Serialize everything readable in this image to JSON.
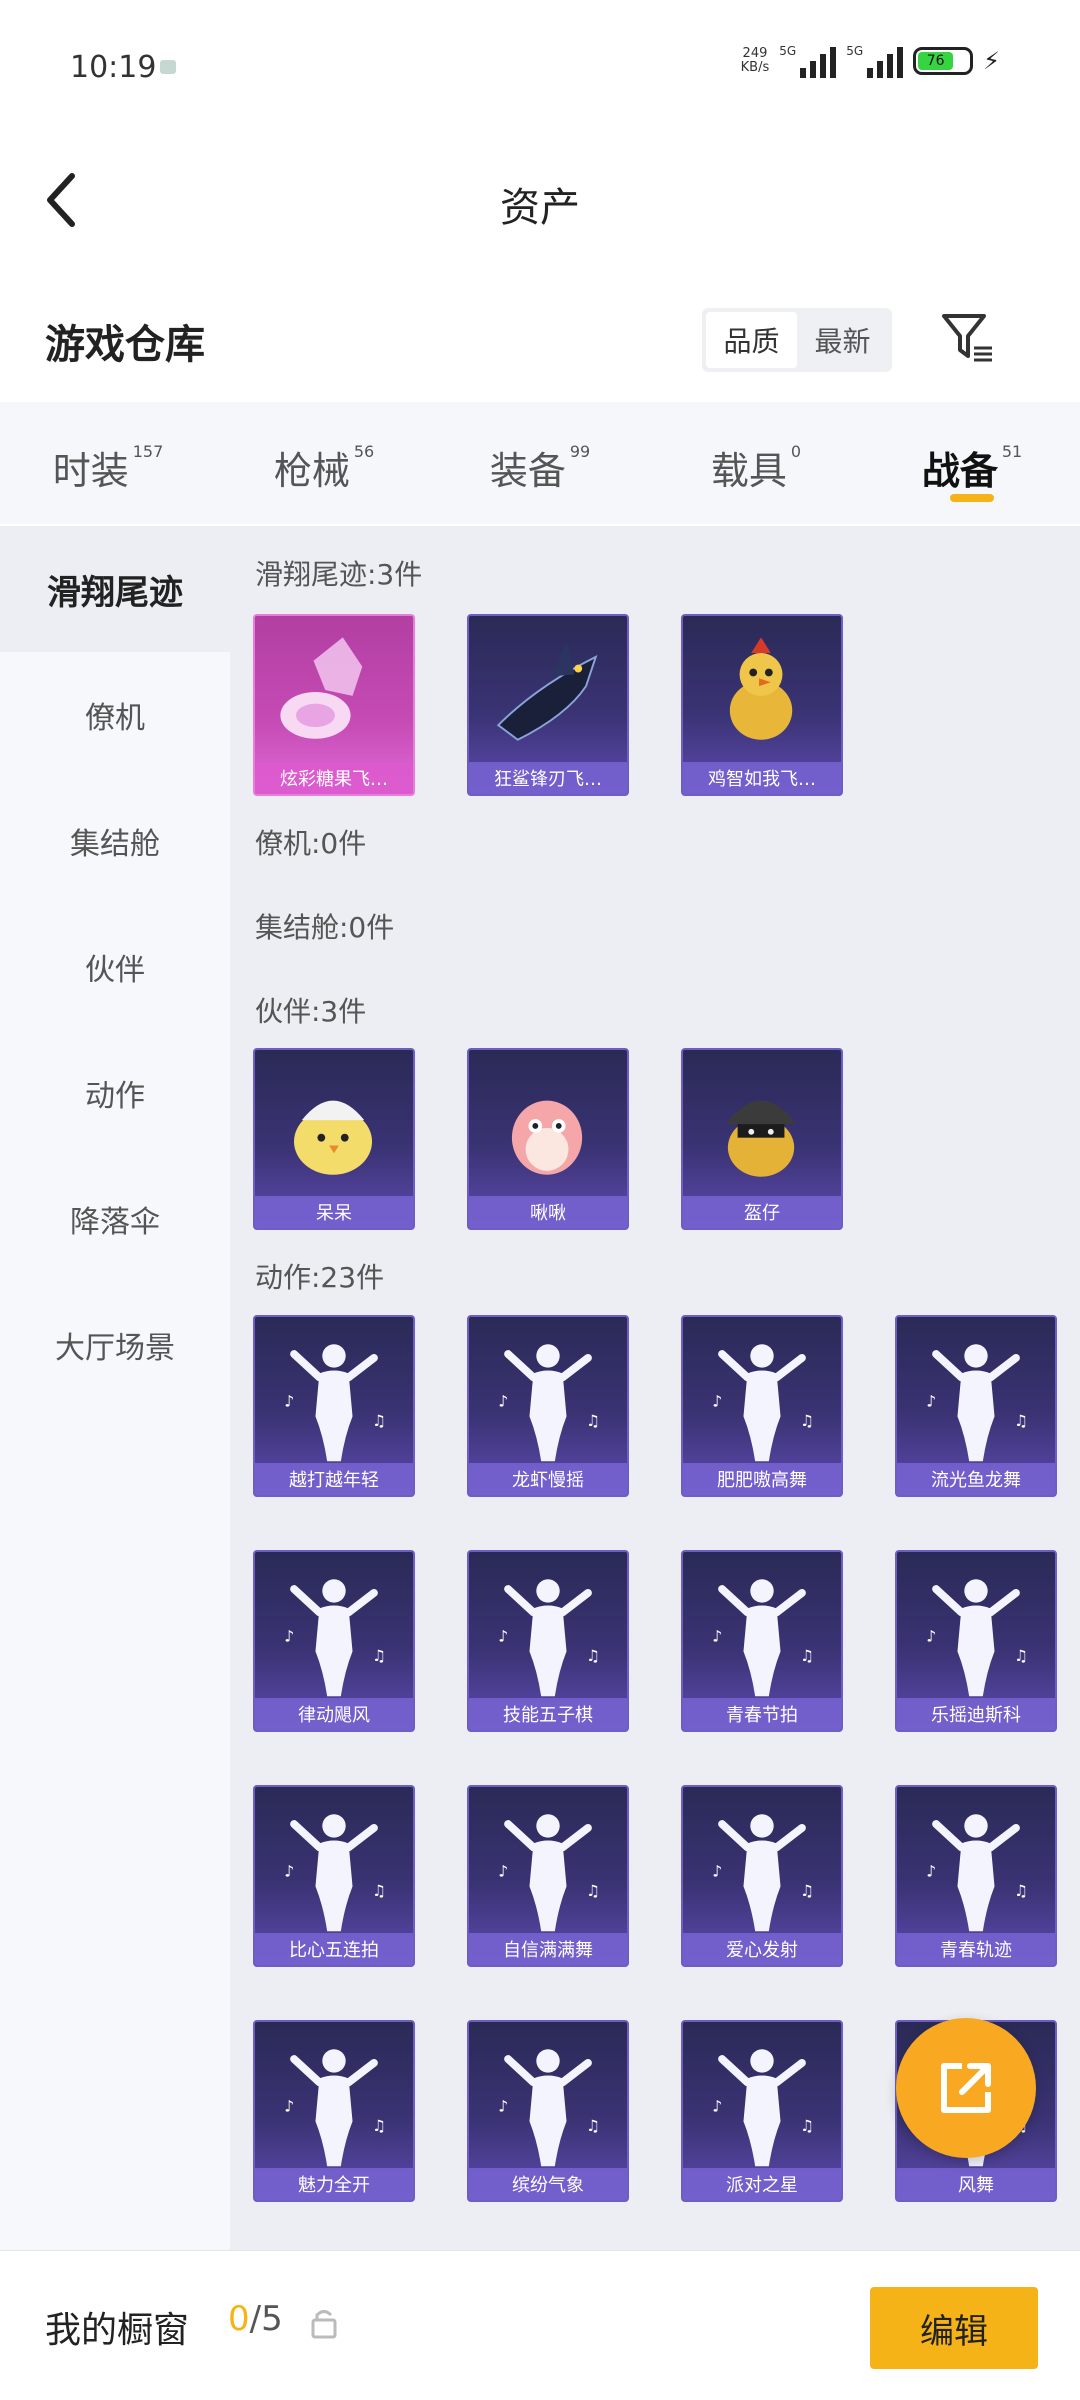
{
  "status_bar": {
    "time": "10:19",
    "net_speed": "249",
    "net_unit": "KB/s",
    "signal1": "5G",
    "signal2": "5G",
    "battery": "76"
  },
  "header": {
    "title": "资产"
  },
  "warehouse": {
    "title": "游戏仓库",
    "sort_quality": "品质",
    "sort_newest": "最新"
  },
  "categories": [
    {
      "label": "时装",
      "count": "157"
    },
    {
      "label": "枪械",
      "count": "56"
    },
    {
      "label": "装备",
      "count": "99"
    },
    {
      "label": "载具",
      "count": "0"
    },
    {
      "label": "战备",
      "count": "51"
    }
  ],
  "sidebar": [
    "滑翔尾迹",
    "僚机",
    "集结舱",
    "伙伴",
    "动作",
    "降落伞",
    "大厅场景"
  ],
  "sections": {
    "glide": {
      "title": "滑翔尾迹:3件",
      "items": [
        "炫彩糖果飞…",
        "狂鲨锋刃飞…",
        "鸡智如我飞…"
      ]
    },
    "wingman": {
      "title": "僚机:0件"
    },
    "capsule": {
      "title": "集结舱:0件"
    },
    "partner": {
      "title": "伙伴:3件",
      "items": [
        "呆呆",
        "啾啾",
        "盔仔"
      ]
    },
    "emote": {
      "title": "动作:23件",
      "items": [
        "越打越年轻",
        "龙虾慢摇",
        "肥肥嗷高舞",
        "流光鱼龙舞",
        "律动飓风",
        "技能五子棋",
        "青春节拍",
        "乐摇迪斯科",
        "比心五连拍",
        "自信满满舞",
        "爱心发射",
        "青春轨迹",
        "魅力全开",
        "缤纷气象",
        "派对之星",
        "风舞"
      ]
    }
  },
  "bottom": {
    "showcase_label": "我的橱窗",
    "showcase_current": "0",
    "showcase_total": "/5",
    "edit_label": "编辑"
  }
}
